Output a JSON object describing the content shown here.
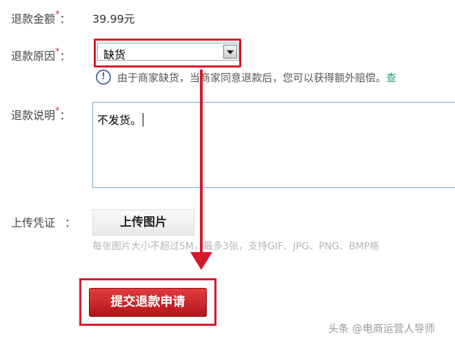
{
  "form": {
    "amount": {
      "label": "退款金额",
      "required_mark": "*",
      "colon": "：",
      "value": "39.99元"
    },
    "reason": {
      "label": "退款原因",
      "required_mark": "*",
      "colon": "：",
      "selected": "缺货"
    },
    "notice": {
      "icon": "!",
      "text": "由于商家缺货，当商家同意退款后，您可以获得额外赔偿。",
      "link": "查"
    },
    "description": {
      "label": "退款说明",
      "required_mark": "*",
      "colon": "：",
      "value": "不发货。"
    },
    "evidence": {
      "label": "上传凭证",
      "colon": "：",
      "button": "上传图片",
      "hint": "每张图片大小不超过5M，最多3张，支持GIF、JPG、PNG、BMP格"
    },
    "submit": "提交退款申请"
  },
  "watermark": "头条 @电商运营人导师",
  "colors": {
    "highlight": "#d6182b",
    "submit": "#c8181f",
    "arrow": "#d6182b",
    "info": "#5a6f9a"
  }
}
